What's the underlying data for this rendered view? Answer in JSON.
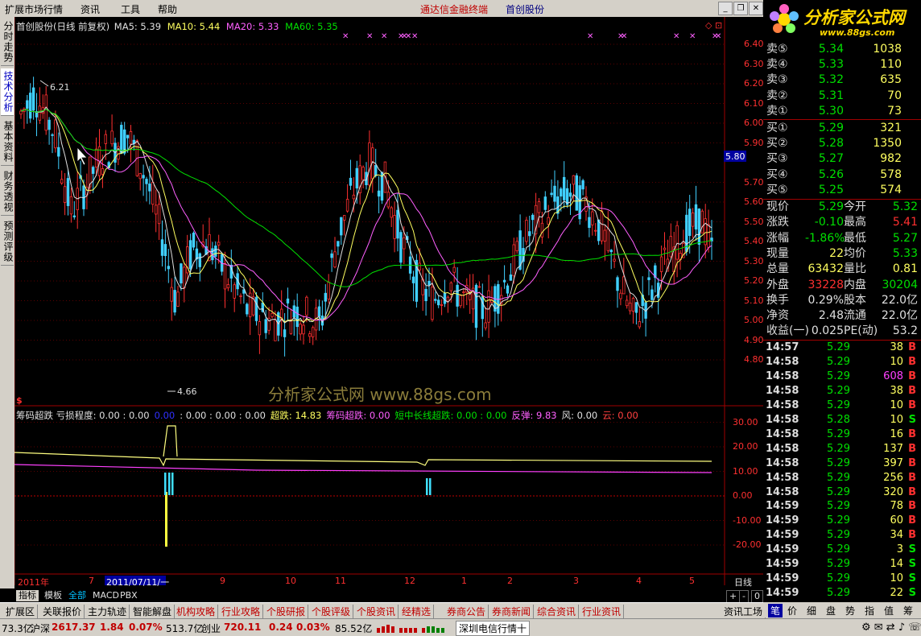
{
  "menu": {
    "items": [
      "扩展市场行情",
      "资讯",
      "工具",
      "帮助"
    ],
    "brand_app": "通达信金融终端",
    "brand_broker": "首创股份"
  },
  "logo": {
    "title": "分析家公式网",
    "url": "www.88gs.com"
  },
  "left_tabs": [
    "分时走势",
    "技术分析",
    "基本资料",
    "财务透视",
    "预测评级"
  ],
  "chart": {
    "header": {
      "title": "首创股份(日线 前复权)",
      "ma5": "MA5: 5.39",
      "ma10": "MA10: 5.44",
      "ma20": "MA20: 5.33",
      "ma60": "MA60: 5.35"
    },
    "price_axis": [
      "6.40",
      "6.30",
      "6.20",
      "6.10",
      "6.00",
      "5.90",
      "5.70",
      "5.60",
      "5.50",
      "5.40",
      "5.30",
      "5.20",
      "5.10",
      "5.00",
      "4.90",
      "4.80"
    ],
    "price_marker": "5.80",
    "high_label": "6.21",
    "low_label": "4.66",
    "watermark": "分析家公式网 www.88gs.com",
    "dollar": "$",
    "indicator_header": [
      {
        "text": "筹码超跌  亏损程度: 0.00 : 0.00",
        "color": "#e0e0e0"
      },
      {
        "text": "0.00",
        "color": "#3030ff"
      },
      {
        "text": ": 0.00 : 0.00 : 0.00",
        "color": "#e0e0e0"
      },
      {
        "text": "超跌: 14.83",
        "color": "#ffff60"
      },
      {
        "text": "筹码超跌: 0.00",
        "color": "#ff60ff"
      },
      {
        "text": "短中长线超跌: 0.00 : 0.00",
        "color": "#00e000"
      },
      {
        "text": "反弹: 9.83",
        "color": "#ff60ff"
      },
      {
        "text": "风: 0.00",
        "color": "#e0e0e0"
      },
      {
        "text": "云: 0.00",
        "color": "#ff4040"
      }
    ],
    "indicator_axis": [
      "30.00",
      "20.00",
      "10.00",
      "0.00",
      "-10.00",
      "-20.00"
    ],
    "date_axis": {
      "year": "2011年",
      "months": [
        "7",
        "9",
        "10",
        "11",
        "12",
        "1",
        "2",
        "3",
        "4",
        "5"
      ],
      "cursor": "2011/07/11/一",
      "period": "日线"
    },
    "bottom_tabs": [
      "指标",
      "模板",
      "全部",
      "MACD",
      "PBX"
    ],
    "bottom_controls": [
      "+",
      "-",
      "0"
    ]
  },
  "quote": {
    "sell": [
      {
        "label": "卖⑤",
        "price": "5.34",
        "vol": "1038"
      },
      {
        "label": "卖④",
        "price": "5.33",
        "vol": "110"
      },
      {
        "label": "卖③",
        "price": "5.32",
        "vol": "635"
      },
      {
        "label": "卖②",
        "price": "5.31",
        "vol": "70"
      },
      {
        "label": "卖①",
        "price": "5.30",
        "vol": "73"
      }
    ],
    "buy": [
      {
        "label": "买①",
        "price": "5.29",
        "vol": "321"
      },
      {
        "label": "买②",
        "price": "5.28",
        "vol": "1350"
      },
      {
        "label": "买③",
        "price": "5.27",
        "vol": "982"
      },
      {
        "label": "买④",
        "price": "5.26",
        "vol": "578"
      },
      {
        "label": "买⑤",
        "price": "5.25",
        "vol": "574"
      }
    ],
    "stats": [
      {
        "l1": "现价",
        "v1": "5.29",
        "c1": "#00e000",
        "l2": "今开",
        "v2": "5.32",
        "c2": "#00e000"
      },
      {
        "l1": "涨跌",
        "v1": "-0.10",
        "c1": "#00e000",
        "l2": "最高",
        "v2": "5.41",
        "c2": "#ff3030"
      },
      {
        "l1": "涨幅",
        "v1": "-1.86%",
        "c1": "#00e000",
        "l2": "最低",
        "v2": "5.27",
        "c2": "#00e000"
      },
      {
        "l1": "现量",
        "v1": "22",
        "c1": "#ffff60",
        "l2": "均价",
        "v2": "5.33",
        "c2": "#00e000"
      },
      {
        "l1": "总量",
        "v1": "63432",
        "c1": "#ffff60",
        "l2": "量比",
        "v2": "0.81",
        "c2": "#ffff60"
      },
      {
        "l1": "外盘",
        "v1": "33228",
        "c1": "#ff3030",
        "l2": "内盘",
        "v2": "30204",
        "c2": "#00e000"
      },
      {
        "l1": "换手",
        "v1": "0.29%",
        "c1": "#e0e0e0",
        "l2": "股本",
        "v2": "22.0亿",
        "c2": "#e0e0e0"
      },
      {
        "l1": "净资",
        "v1": "2.48",
        "c1": "#e0e0e0",
        "l2": "流通",
        "v2": "22.0亿",
        "c2": "#e0e0e0"
      },
      {
        "l1": "收益(一)",
        "v1": "0.025",
        "c1": "#e0e0e0",
        "l2": "PE(动)",
        "v2": "53.2",
        "c2": "#e0e0e0"
      }
    ],
    "ticks": [
      {
        "time": "14:57",
        "price": "5.29",
        "vol": "38",
        "dir": "B",
        "vc": "#ffff60"
      },
      {
        "time": "14:58",
        "price": "5.29",
        "vol": "10",
        "dir": "B",
        "vc": "#ffff60"
      },
      {
        "time": "14:58",
        "price": "5.29",
        "vol": "608",
        "dir": "B",
        "vc": "#ff40ff"
      },
      {
        "time": "14:58",
        "price": "5.29",
        "vol": "38",
        "dir": "B",
        "vc": "#ffff60"
      },
      {
        "time": "14:58",
        "price": "5.29",
        "vol": "10",
        "dir": "B",
        "vc": "#ffff60"
      },
      {
        "time": "14:58",
        "price": "5.28",
        "vol": "10",
        "dir": "S",
        "vc": "#ffff60"
      },
      {
        "time": "14:58",
        "price": "5.29",
        "vol": "16",
        "dir": "B",
        "vc": "#ffff60"
      },
      {
        "time": "14:58",
        "price": "5.29",
        "vol": "137",
        "dir": "B",
        "vc": "#ffff60"
      },
      {
        "time": "14:58",
        "price": "5.29",
        "vol": "397",
        "dir": "B",
        "vc": "#ffff60"
      },
      {
        "time": "14:58",
        "price": "5.29",
        "vol": "256",
        "dir": "B",
        "vc": "#ffff60"
      },
      {
        "time": "14:58",
        "price": "5.29",
        "vol": "320",
        "dir": "B",
        "vc": "#ffff60"
      },
      {
        "time": "14:59",
        "price": "5.29",
        "vol": "78",
        "dir": "B",
        "vc": "#ffff60"
      },
      {
        "time": "14:59",
        "price": "5.29",
        "vol": "60",
        "dir": "B",
        "vc": "#ffff60"
      },
      {
        "time": "14:59",
        "price": "5.29",
        "vol": "34",
        "dir": "B",
        "vc": "#ffff60"
      },
      {
        "time": "14:59",
        "price": "5.29",
        "vol": "3",
        "dir": "S",
        "vc": "#ffff60"
      },
      {
        "time": "14:59",
        "price": "5.29",
        "vol": "14",
        "dir": "S",
        "vc": "#ffff60"
      },
      {
        "time": "14:59",
        "price": "5.29",
        "vol": "10",
        "dir": "S",
        "vc": "#ffff60"
      },
      {
        "time": "14:59",
        "price": "5.29",
        "vol": "22",
        "dir": "S",
        "vc": "#ffff60"
      }
    ]
  },
  "function_bar": [
    "扩展区",
    "关联报价",
    "主力轨迹",
    "智能解盘",
    "机构攻略",
    "行业攻略",
    "个股研报",
    "个股评级",
    "个股资讯",
    "经精选",
    "券商公告",
    "券商新闻",
    "综合资讯",
    "行业资讯",
    "资讯工场"
  ],
  "right_tabs": [
    "笔",
    "价",
    "细",
    "盘",
    "势",
    "指",
    "值",
    "筹"
  ],
  "status": {
    "sh_amount": "73.3亿",
    "sz_label": "沪深",
    "sz_index": "2617.37",
    "sz_change": "1.84",
    "sz_pct": "0.07%",
    "sz_amount": "513.7亿",
    "cy_label": "创业",
    "cy_index": "720.11",
    "cy_change": "0.24",
    "cy_pct": "0.03%",
    "cy_amount": "85.52亿",
    "server": "深圳电信行情十"
  }
}
